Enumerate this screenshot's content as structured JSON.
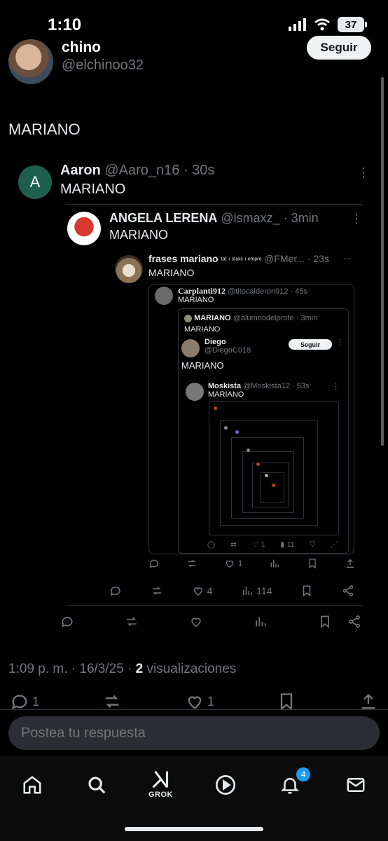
{
  "status_bar": {
    "time": "1:10",
    "battery": "37"
  },
  "author": {
    "name": "chino",
    "handle": "@elchinoo32",
    "follow_label": "Seguir"
  },
  "post": {
    "text": "MARIANO",
    "timestamp": "1:09 p. m. · 16/3/25 · ",
    "views_count": "2",
    "views_label": " visualizaciones"
  },
  "post_actions": {
    "replies": "1",
    "likes": "1"
  },
  "reply_aaron": {
    "avatar_letter": "A",
    "name": "Aaron",
    "handle": "@Aaro_n16",
    "time": "· 30s",
    "text": "MARIANO"
  },
  "reply_angela": {
    "name": "ANGELA LERENA",
    "handle": "@ismaxz_",
    "time": "· 3min",
    "text": "MARIANO"
  },
  "reply_angela_actions": {
    "likes": "4",
    "views": "114"
  },
  "reply_frases": {
    "name": "frases mariano",
    "name_suffix": "ᵗᵃᵗ ᶦ ˢᵗᵃˣˢ ᶦ ᵉᵐᵖʳᵉ",
    "handle": "@FMer...",
    "time": "· 23s",
    "text": "MARIANO"
  },
  "reply_frases_actions": {
    "likes": "1"
  },
  "nested": {
    "carplanti": {
      "name": "Carplanti912",
      "handle": "@titocalderon912",
      "time": "· 45s",
      "text": "MARIANO"
    },
    "mariano": {
      "name": "MARIANO",
      "handle": "@alumnodelprofe",
      "time": "· 3min",
      "text": "MARIANO"
    },
    "diego": {
      "name": "Diego",
      "handle": "@DiegoC018",
      "follow_label": "Seguir",
      "text": "MARIANO"
    },
    "moskista": {
      "name": "Moskista",
      "handle": "@Moskista12",
      "time": "· 53s",
      "text": "MARIANO"
    },
    "inner_likes": "1",
    "inner_views": "11"
  },
  "reply_box": {
    "placeholder": "Postea tu respuesta"
  },
  "tabbar": {
    "grok_label": "GROK",
    "notifications_badge": "4"
  }
}
